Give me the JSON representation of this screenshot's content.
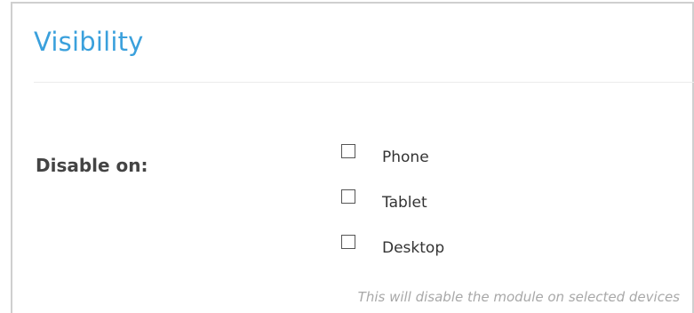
{
  "section": {
    "title": "Visibility"
  },
  "disable_on": {
    "label": "Disable on:",
    "options": [
      {
        "label": "Phone",
        "checked": false
      },
      {
        "label": "Tablet",
        "checked": false
      },
      {
        "label": "Desktop",
        "checked": false
      }
    ],
    "help_text": "This will disable the module on selected devices"
  },
  "colors": {
    "title": "#3aa0dc",
    "border": "#cfcfcf",
    "help_text": "#a8a8a8"
  }
}
